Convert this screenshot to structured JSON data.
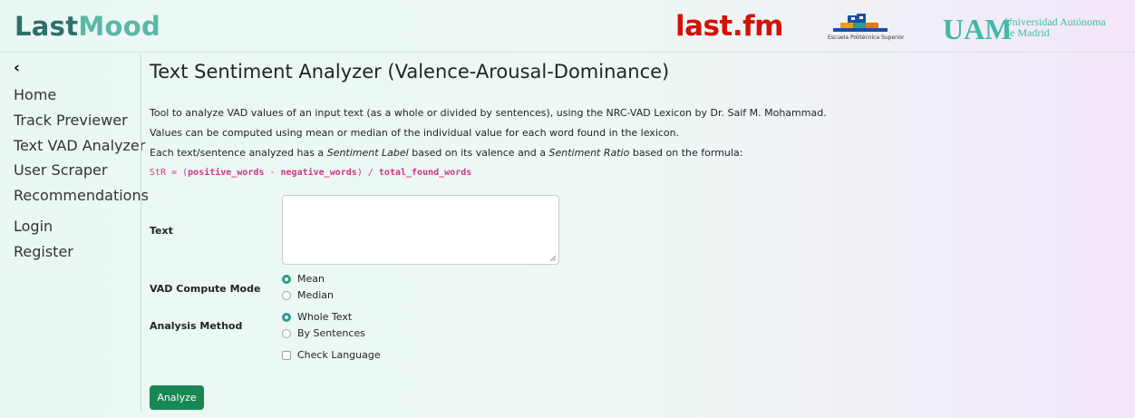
{
  "header": {
    "brand_part1": "Last",
    "brand_part2": "Mood",
    "lastfm_logo": "last.fm",
    "eps_logo": "Escuela Politécnica Superior",
    "uam_letters": "UAM",
    "uam_name_line1": "Universidad Autónoma",
    "uam_name_line2": "de Madrid"
  },
  "sidebar": {
    "back_icon": "‹",
    "items": [
      {
        "label": "Home"
      },
      {
        "label": "Track Previewer"
      },
      {
        "label": "Text VAD Analyzer"
      },
      {
        "label": "User Scraper"
      },
      {
        "label": "Recommendations"
      },
      {
        "label": "Login"
      },
      {
        "label": "Register"
      }
    ]
  },
  "main": {
    "title": "Text Sentiment Analyzer (Valence-Arousal-Dominance)",
    "desc_line1": "Tool to analyze VAD values of an input text (as a whole or divided by sentences), using the NRC-VAD Lexicon by Dr. Saif M. Mohammad.",
    "desc_line2": "Values can be computed using mean or median of the individual value for each word found in the lexicon.",
    "desc_line3_a": "Each text/sentence analyzed has a ",
    "desc_line3_b": "Sentiment Label",
    "desc_line3_c": "  based on its valence and a ",
    "desc_line3_d": "Sentiment Ratio",
    "desc_line3_e": "  based on the formula:",
    "formula_a": "StR = (",
    "formula_b": "positive_words",
    "formula_c": " - ",
    "formula_d": "negative_words",
    "formula_e": ") / ",
    "formula_f": "total_found_words"
  },
  "form": {
    "text_label": "Text",
    "text_value": "",
    "vad_label": "VAD Compute Mode",
    "vad_options": [
      {
        "label": "Mean",
        "checked": true
      },
      {
        "label": "Median",
        "checked": false
      }
    ],
    "method_label": "Analysis Method",
    "method_options": [
      {
        "label": "Whole Text",
        "checked": true
      },
      {
        "label": "By Sentences",
        "checked": false
      }
    ],
    "check_language_label": "Check Language",
    "check_language_checked": false,
    "analyze_label": "Analyze"
  },
  "colors": {
    "accent": "#2c9c85",
    "button": "#198754",
    "code": "#d63384",
    "lastfm": "#d51007"
  }
}
